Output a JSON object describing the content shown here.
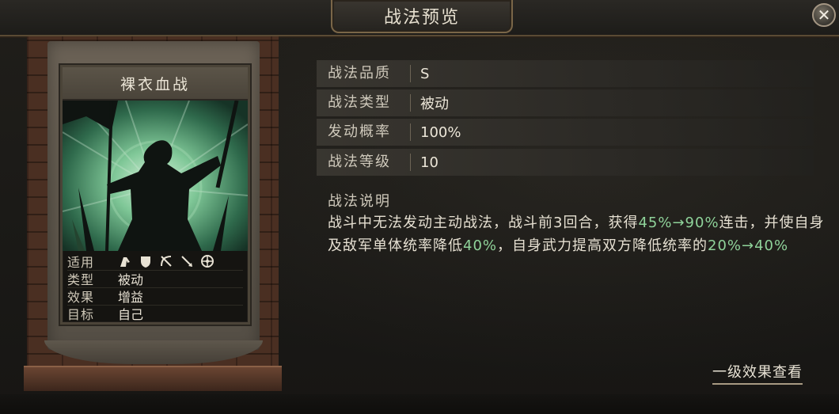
{
  "header": {
    "title": "战法预览",
    "close_symbol": "✕"
  },
  "card": {
    "name": "裸衣血战",
    "info": {
      "troop_label": "适用",
      "troop_icons": [
        "cavalry-icon",
        "shield-icon",
        "bow-icon",
        "spear-icon",
        "wheel-icon"
      ],
      "type_label": "类型",
      "type_value": "被动",
      "effect_label": "效果",
      "effect_value": "增益",
      "target_label": "目标",
      "target_value": "自己"
    }
  },
  "attributes": [
    {
      "label": "战法品质",
      "value": "S"
    },
    {
      "label": "战法类型",
      "value": "被动"
    },
    {
      "label": "发动概率",
      "value": "100%"
    },
    {
      "label": "战法等级",
      "value": "10"
    }
  ],
  "description": {
    "title": "战法说明",
    "parts": {
      "p1": "战斗中无法发动主动战法，战斗前",
      "n1": "3",
      "p2": "回合，获得",
      "h1": "45%→90%",
      "p3": "连击，并使自身及敌军单体统率降低",
      "h2": "40%",
      "p4": "，自身武力提高双方降低统率的",
      "h3": "20%→40%"
    }
  },
  "footer": {
    "level_effect_link": "一级效果查看"
  },
  "colors": {
    "highlight": "#8fd39a",
    "accent_border": "#7a6648"
  }
}
